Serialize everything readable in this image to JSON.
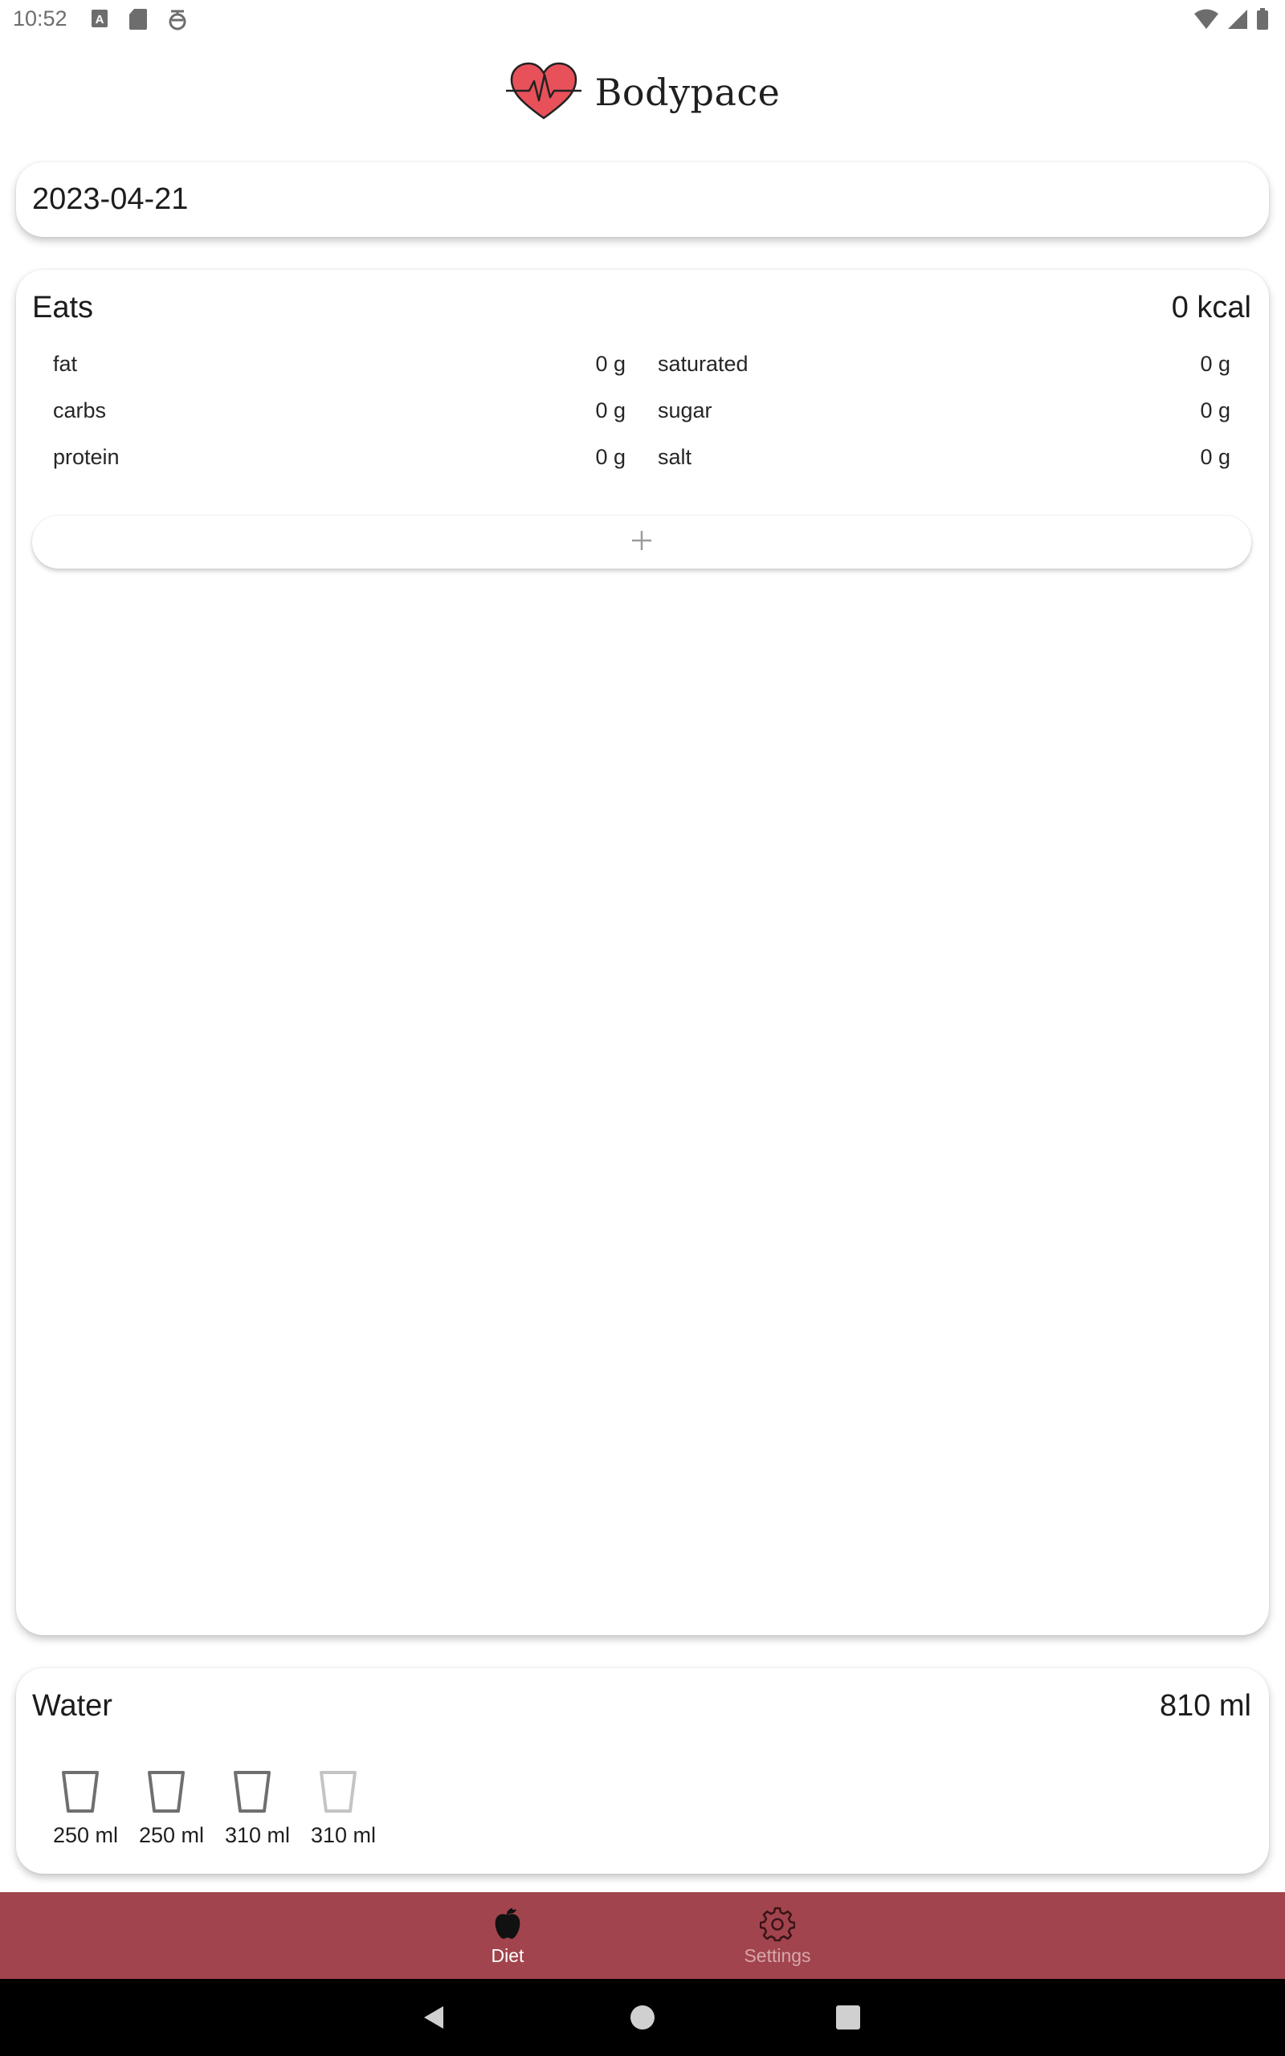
{
  "status_bar": {
    "time": "10:52",
    "left_icons": [
      "keyboard-a-icon",
      "sd-card-icon",
      "notification-icon"
    ],
    "right_icons": [
      "wifi-icon",
      "cell-signal-icon",
      "battery-icon"
    ]
  },
  "header": {
    "title": "Bodypace",
    "logo": "heart-pulse-icon"
  },
  "date_picker": {
    "value": "2023-04-21"
  },
  "eats": {
    "title": "Eats",
    "total": "0 kcal",
    "nutrients_left": [
      {
        "label": "fat",
        "value": "0 g"
      },
      {
        "label": "carbs",
        "value": "0 g"
      },
      {
        "label": "protein",
        "value": "0 g"
      }
    ],
    "nutrients_right": [
      {
        "label": "saturated",
        "value": "0 g"
      },
      {
        "label": "sugar",
        "value": "0 g"
      },
      {
        "label": "salt",
        "value": "0 g"
      }
    ],
    "add_icon": "plus-icon"
  },
  "water": {
    "title": "Water",
    "total": "810 ml",
    "glasses": [
      {
        "label": "250 ml",
        "filled": true
      },
      {
        "label": "250 ml",
        "filled": true
      },
      {
        "label": "310 ml",
        "filled": true
      },
      {
        "label": "310 ml",
        "filled": false
      }
    ]
  },
  "bottom_nav": {
    "items": [
      {
        "label": "Diet",
        "icon": "apple-icon",
        "active": true
      },
      {
        "label": "Settings",
        "icon": "gear-icon",
        "active": false
      }
    ]
  },
  "system_nav": {
    "buttons": [
      "back-icon",
      "home-icon",
      "recents-icon"
    ]
  },
  "colors": {
    "accent": "#a2444d",
    "heart": "#e8515a",
    "inactive_nav_text": "#d7a7ac"
  }
}
